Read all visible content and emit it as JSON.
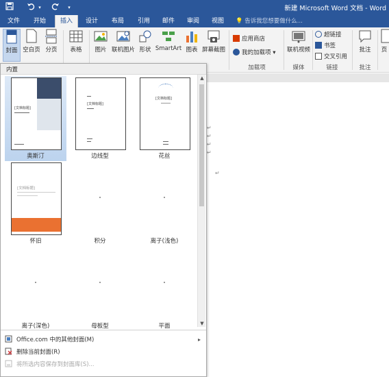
{
  "window": {
    "title": "新建 Microsoft Word 文档 - Word"
  },
  "qat": {
    "save_icon": "save-icon",
    "undo_icon": "undo-icon",
    "dropdown_icon": "dropdown-arrow",
    "redo_icon": "redo-icon",
    "customize_icon": "customize-qat-icon"
  },
  "tabs": [
    {
      "label": "文件"
    },
    {
      "label": "开始"
    },
    {
      "label": "插入"
    },
    {
      "label": "设计"
    },
    {
      "label": "布局"
    },
    {
      "label": "引用"
    },
    {
      "label": "邮件"
    },
    {
      "label": "审阅"
    },
    {
      "label": "视图"
    }
  ],
  "tellme": {
    "text": "告诉我您想要做什么..."
  },
  "ribbon": {
    "pages": {
      "cover": "封面",
      "blank": "空白页",
      "break": "分页"
    },
    "table": "表格",
    "illustrations": {
      "picture": "图片",
      "online_picture": "联机图片",
      "shapes": "形状",
      "smartart": "SmartArt",
      "chart": "图表",
      "screenshot": "屏幕截图"
    },
    "addins": {
      "store": "应用商店",
      "my_addins": "我的加载项",
      "group": "加载项"
    },
    "media": {
      "online_video": "联机视频",
      "group": "媒体"
    },
    "links": {
      "hyperlink": "超链接",
      "bookmark": "书签",
      "cross_ref": "交叉引用",
      "group": "链接"
    },
    "comments": {
      "comment": "批注",
      "group": "批注"
    },
    "header": "页"
  },
  "gallery": {
    "section": "内置",
    "covers": [
      {
        "name": "奥斯汀",
        "thumb_title": "[文档标题]"
      },
      {
        "name": "边线型",
        "thumb_title": "[文档标题]"
      },
      {
        "name": "花丝",
        "thumb_title": "[文档标题]"
      },
      {
        "name": "怀旧",
        "thumb_title": "[文档标题]"
      },
      {
        "name": "积分",
        "thumb_title": ""
      },
      {
        "name": "离子(浅色)",
        "thumb_title": ""
      },
      {
        "name": "离子(深色)",
        "thumb_title": ""
      },
      {
        "name": "母板型",
        "thumb_title": ""
      },
      {
        "name": "平面",
        "thumb_title": ""
      }
    ],
    "footer": [
      {
        "label": "Office.com 中的其他封面(M)",
        "disabled": false
      },
      {
        "label": "删除当前封面(R)",
        "disabled": false
      },
      {
        "label": "将所选内容保存到封面库(S)...",
        "disabled": true
      }
    ]
  },
  "document": {
    "para_marks": [
      "↵",
      "↵",
      "↵",
      "↵",
      "↵"
    ]
  },
  "colors": {
    "brand": "#2b579a",
    "selection": "#bcd3ee",
    "orange": "#ea7131",
    "navy": "#3b4d6b"
  }
}
